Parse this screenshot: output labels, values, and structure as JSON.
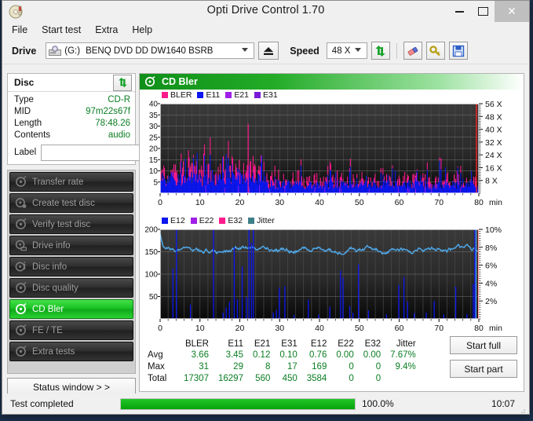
{
  "window": {
    "title": "Opti Drive Control 1.70",
    "icon": "disc-icon",
    "minimize_label": "–",
    "maximize_label": "☐",
    "close_label": "✕"
  },
  "menu": {
    "items": [
      {
        "label": "File",
        "name": "menu-file"
      },
      {
        "label": "Start test",
        "name": "menu-start-test"
      },
      {
        "label": "Extra",
        "name": "menu-extra"
      },
      {
        "label": "Help",
        "name": "menu-help"
      }
    ]
  },
  "toolbar": {
    "drive_label": "Drive",
    "drive_letter": "(G:)",
    "drive_name": "BENQ DVD DD DW1640 BSRB",
    "eject_icon": "eject-icon",
    "speed_label": "Speed",
    "speed_value": "48 X",
    "refresh_icon": "refresh-arrows-icon",
    "eraser_icon": "eraser-icon",
    "key_icon": "key-icon",
    "save_icon": "floppy-save-icon"
  },
  "disc": {
    "title": "Disc",
    "refresh_icon": "refresh-arrows-icon",
    "rows": [
      {
        "key": "Type",
        "value": "CD-R"
      },
      {
        "key": "MID",
        "value": "97m22s67f"
      },
      {
        "key": "Length",
        "value": "78:48.26"
      },
      {
        "key": "Contents",
        "value": "audio"
      }
    ],
    "label_key": "Label",
    "label_value": "",
    "label_placeholder": "",
    "label_button_icon": "cd-disc-icon"
  },
  "nav": {
    "items": [
      {
        "label": "Transfer rate",
        "name": "sidebar-item-transfer-rate",
        "icon": "disc-scan-icon",
        "active": false
      },
      {
        "label": "Create test disc",
        "name": "sidebar-item-create-test-disc",
        "icon": "disc-burn-icon",
        "active": false
      },
      {
        "label": "Verify test disc",
        "name": "sidebar-item-verify-test-disc",
        "icon": "disc-check-icon",
        "active": false
      },
      {
        "label": "Drive info",
        "name": "sidebar-item-drive-info",
        "icon": "drive-info-icon",
        "active": false
      },
      {
        "label": "Disc info",
        "name": "sidebar-item-disc-info",
        "icon": "disc-info-icon",
        "active": false
      },
      {
        "label": "Disc quality",
        "name": "sidebar-item-disc-quality",
        "icon": "disc-quality-icon",
        "active": false
      },
      {
        "label": "CD Bler",
        "name": "sidebar-item-cd-bler",
        "icon": "disc-bler-icon",
        "active": true
      },
      {
        "label": "FE / TE",
        "name": "sidebar-item-fe-te",
        "icon": "disc-fete-icon",
        "active": false
      },
      {
        "label": "Extra tests",
        "name": "sidebar-item-extra-tests",
        "icon": "disc-extra-icon",
        "active": false
      }
    ],
    "status_window_label": "Status window > >"
  },
  "panel": {
    "title": "CD Bler",
    "icon": "disc-bler-icon"
  },
  "actions": {
    "start_full": "Start full",
    "start_part": "Start part"
  },
  "statusbar": {
    "status": "Test completed",
    "progress_pct_label": "100.0%",
    "progress_value": 100,
    "time": "10:07"
  },
  "colors": {
    "bler": "#ff1a8c",
    "e11": "#0b16f0",
    "e21": "#a01ee8",
    "e31": "#7a1ad8",
    "e12": "#0b16f0",
    "e22": "#a01ee8",
    "e32": "#ff1a8c",
    "jitter": "#3f7f87",
    "jitter_trace": "#4ea7e8",
    "speed_trace": "#ff2020",
    "accent_green": "#17c020",
    "value_green": "#0a7d22"
  },
  "chart_data": [
    {
      "type": "line",
      "name": "cd-bler-chart-top",
      "title": "CD Bler",
      "xlabel": "min",
      "ylabel": "",
      "xlim": [
        0,
        80
      ],
      "ylim": [
        0,
        40
      ],
      "xticks": [
        0,
        10,
        20,
        30,
        40,
        50,
        60,
        70,
        80
      ],
      "yticks": [
        5,
        10,
        15,
        20,
        25,
        30,
        35,
        40
      ],
      "y2label": "X",
      "y2lim": [
        0,
        56
      ],
      "y2ticks": [
        "8 X",
        "16 X",
        "24 X",
        "32 X",
        "40 X",
        "48 X",
        "56 X"
      ],
      "grid": true,
      "legend_position": "top-left",
      "legend": [
        {
          "name": "BLER",
          "color": "#ff1a8c"
        },
        {
          "name": "E11",
          "color": "#0b16f0"
        },
        {
          "name": "E21",
          "color": "#a01ee8"
        },
        {
          "name": "E31",
          "color": "#7a1ad8"
        }
      ],
      "series": [
        {
          "name": "BLER",
          "color": "#ff1a8c",
          "avg": 3.66,
          "max": 31,
          "total": 17307
        },
        {
          "name": "E11",
          "color": "#0b16f0",
          "avg": 3.45,
          "max": 29,
          "total": 16297
        },
        {
          "name": "E21",
          "color": "#a01ee8",
          "avg": 0.12,
          "max": 8,
          "total": 560
        },
        {
          "name": "E31",
          "color": "#7a1ad8",
          "avg": 0.1,
          "max": 17,
          "total": 450
        }
      ],
      "read_speed": {
        "name": "Speed",
        "color": "#ff2020",
        "end_x": 80,
        "end_value": 56
      }
    },
    {
      "type": "line",
      "name": "cd-bler-chart-bottom",
      "title": "",
      "xlabel": "min",
      "ylabel": "",
      "xlim": [
        0,
        80
      ],
      "ylim": [
        0,
        200
      ],
      "xticks": [
        0,
        10,
        20,
        30,
        40,
        50,
        60,
        70,
        80
      ],
      "yticks": [
        50,
        100,
        150,
        200
      ],
      "y2label": "%",
      "y2lim": [
        0,
        10
      ],
      "y2ticks": [
        "2%",
        "4%",
        "6%",
        "8%",
        "10%"
      ],
      "grid": true,
      "legend_position": "top-left",
      "legend": [
        {
          "name": "E12",
          "color": "#0b16f0"
        },
        {
          "name": "E22",
          "color": "#a01ee8"
        },
        {
          "name": "E32",
          "color": "#ff1a8c"
        },
        {
          "name": "Jitter",
          "color": "#3f7f87"
        }
      ],
      "series": [
        {
          "name": "E12",
          "color": "#0b16f0",
          "avg": 0.76,
          "max": 169,
          "total": 3584
        },
        {
          "name": "E22",
          "color": "#a01ee8",
          "avg": 0.0,
          "max": 0,
          "total": 0
        },
        {
          "name": "E32",
          "color": "#ff1a8c",
          "avg": 0.0,
          "max": 0,
          "total": 0
        },
        {
          "name": "Jitter",
          "color": "#4ea7e8",
          "avg": "7.67%",
          "max": "9.4%",
          "total": ""
        }
      ]
    }
  ],
  "stats": {
    "columns": [
      "BLER",
      "E11",
      "E21",
      "E31",
      "E12",
      "E22",
      "E32",
      "Jitter"
    ],
    "rows": [
      {
        "label": "Avg",
        "values": [
          "3.66",
          "3.45",
          "0.12",
          "0.10",
          "0.76",
          "0.00",
          "0.00",
          "7.67%"
        ]
      },
      {
        "label": "Max",
        "values": [
          "31",
          "29",
          "8",
          "17",
          "169",
          "0",
          "0",
          "9.4%"
        ]
      },
      {
        "label": "Total",
        "values": [
          "17307",
          "16297",
          "560",
          "450",
          "3584",
          "0",
          "0",
          ""
        ]
      }
    ]
  }
}
